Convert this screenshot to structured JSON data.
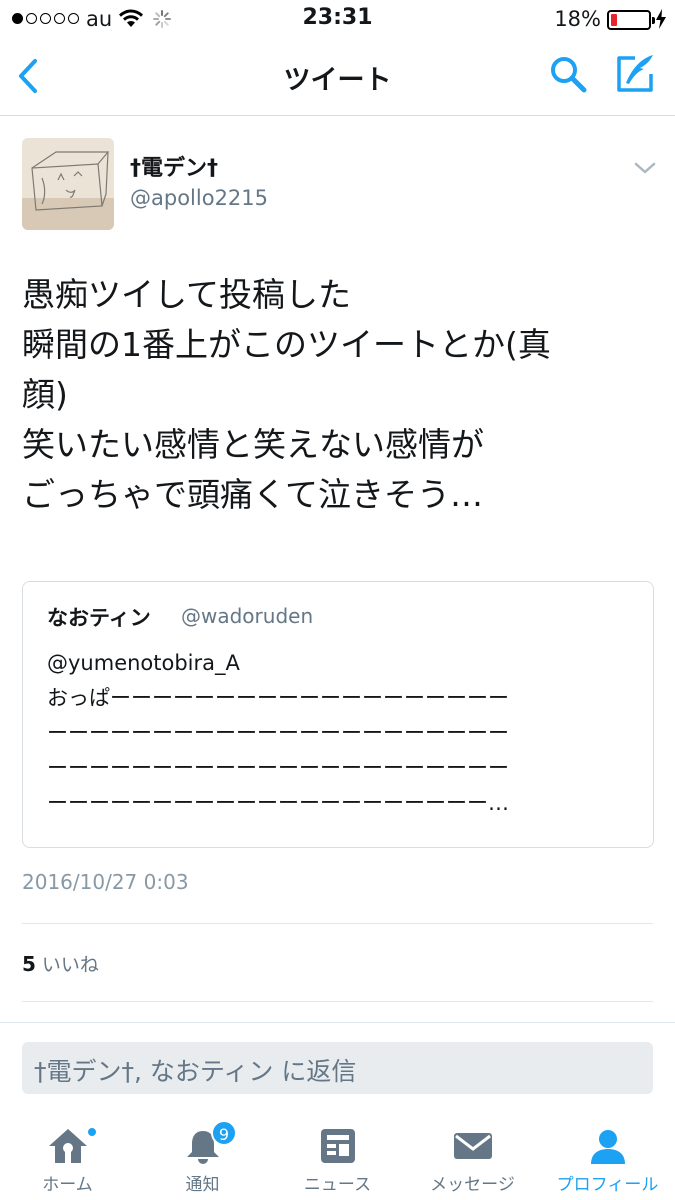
{
  "status_bar": {
    "carrier": "au",
    "time": "23:31",
    "battery_percent": "18%",
    "battery_level": 0.18,
    "signal_bars_filled": 1,
    "signal_bars_total": 5
  },
  "nav": {
    "title": "ツイート",
    "back_icon": "chevron-left-icon",
    "search_icon": "search-icon",
    "compose_icon": "compose-tweet-icon"
  },
  "tweet": {
    "display_name": "†電デン†",
    "handle": "@apollo2215",
    "text_lines": [
      "愚痴ツイして投稿した",
      "瞬間の1番上がこのツイートとか(真",
      "顔)",
      "笑いたい感情と笑えない感情が",
      "ごっちゃで頭痛くて泣きそう…"
    ],
    "timestamp": "2016/10/27 0:03",
    "like_count": "5",
    "like_label": "いいね"
  },
  "quoted_tweet": {
    "display_name": "なおティン",
    "handle": "@wadoruden",
    "lines": [
      "@yumenotobira_A",
      "おっぱーーーーーーーーーーーーーーーーーーー",
      "ーーーーーーーーーーーーーーーーーーーーーー",
      "ーーーーーーーーーーーーーーーーーーーーーー",
      "ーーーーーーーーーーーーーーーーーーーーー…"
    ]
  },
  "reply": {
    "placeholder": "†電デン†, なおティン に返信"
  },
  "tabs": [
    {
      "label": "ホーム",
      "icon": "home-icon"
    },
    {
      "label": "通知",
      "icon": "bell-icon",
      "badge": "9"
    },
    {
      "label": "ニュース",
      "icon": "news-icon"
    },
    {
      "label": "メッセージ",
      "icon": "envelope-icon"
    },
    {
      "label": "プロフィール",
      "icon": "profile-icon"
    }
  ],
  "colors": {
    "accent": "#1da1f2",
    "secondary_text": "#657786",
    "battery_low": "#e8242c"
  }
}
